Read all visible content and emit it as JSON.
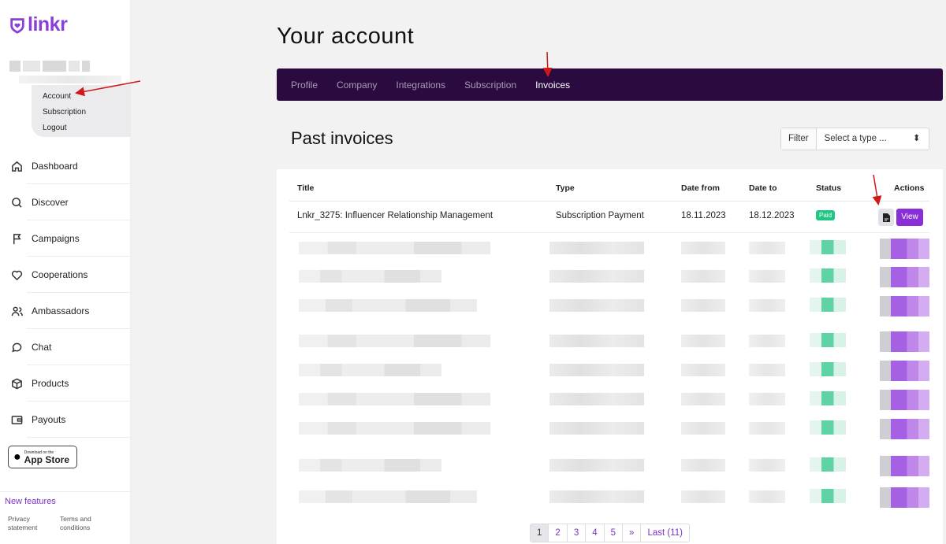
{
  "brand": {
    "name": "linkr",
    "color": "#8a3fd6"
  },
  "account_menu": [
    "Account",
    "Subscription",
    "Logout"
  ],
  "nav": [
    {
      "label": "Dashboard",
      "icon": "home-icon"
    },
    {
      "label": "Discover",
      "icon": "search-icon"
    },
    {
      "label": "Campaigns",
      "icon": "flag-icon"
    },
    {
      "label": "Cooperations",
      "icon": "heart-icon"
    },
    {
      "label": "Ambassadors",
      "icon": "users-icon"
    },
    {
      "label": "Chat",
      "icon": "chat-icon"
    },
    {
      "label": "Products",
      "icon": "box-icon"
    },
    {
      "label": "Payouts",
      "icon": "wallet-icon"
    }
  ],
  "appstore": {
    "small": "Download on the",
    "big": "App Store"
  },
  "new_features": "New features",
  "footer": {
    "privacy": "Privacy statement",
    "terms": "Terms and conditions"
  },
  "page_title": "Your account",
  "tabs": [
    "Profile",
    "Company",
    "Integrations",
    "Subscription",
    "Invoices"
  ],
  "active_tab": "Invoices",
  "section_title": "Past invoices",
  "filter": {
    "label": "Filter",
    "placeholder": "Select a type ...",
    "caret": "⬍"
  },
  "table": {
    "headers": {
      "title": "Title",
      "type": "Type",
      "date_from": "Date from",
      "date_to": "Date to",
      "status": "Status",
      "actions": "Actions"
    },
    "row": {
      "title": "Lnkr_3275: Influencer Relationship Management",
      "type": "Subscription Payment",
      "date_from": "18.11.2023",
      "date_to": "18.12.2023",
      "status": "Paid",
      "view": "View"
    }
  },
  "pagination": [
    "1",
    "2",
    "3",
    "4",
    "5",
    "»",
    "Last (11)"
  ],
  "colors": {
    "tab_bar": "#2a0a3f",
    "accent": "#8a2fd6",
    "paid": "#20c783"
  }
}
